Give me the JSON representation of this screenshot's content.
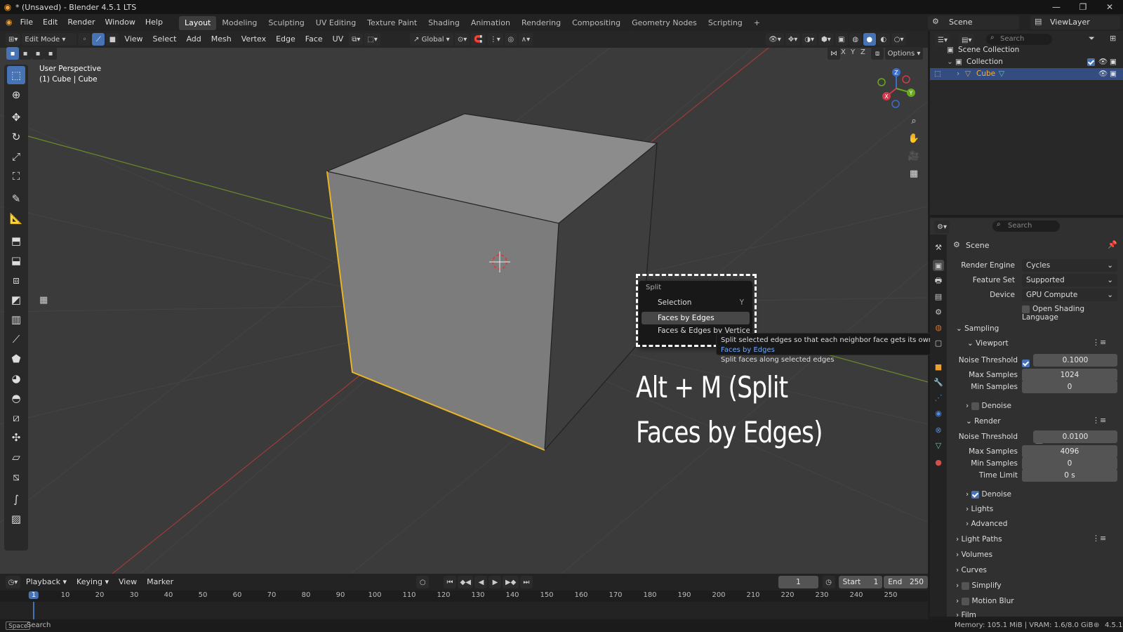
{
  "window": {
    "title": "* (Unsaved) - Blender 4.5.1 LTS"
  },
  "menus": [
    "File",
    "Edit",
    "Render",
    "Window",
    "Help"
  ],
  "workspaces": [
    "Layout",
    "Modeling",
    "Sculpting",
    "UV Editing",
    "Texture Paint",
    "Shading",
    "Animation",
    "Rendering",
    "Compositing",
    "Geometry Nodes",
    "Scripting"
  ],
  "active_workspace": "Layout",
  "scene": {
    "name": "Scene",
    "view_layer": "ViewLayer"
  },
  "viewport_header": {
    "mode": "Edit Mode",
    "menus": [
      "View",
      "Select",
      "Add",
      "Mesh",
      "Vertex",
      "Edge",
      "Face",
      "UV"
    ],
    "orientation": "Global",
    "options_label": "Options",
    "axes": [
      "X",
      "Y",
      "Z"
    ]
  },
  "viewport_info": {
    "line1": "User Perspective",
    "line2": "(1) Cube | Cube"
  },
  "split_menu": {
    "title": "Split",
    "items": [
      {
        "label": "Selection",
        "shortcut": "Y"
      },
      {
        "label": "Faces by Edges",
        "shortcut": ""
      },
      {
        "label": "Faces & Edges by Vertices",
        "shortcut": ""
      }
    ],
    "highlighted": "Faces by Edges"
  },
  "tooltip": {
    "line1": "Split selected edges so that each neighbor face gets its own copy:",
    "hint": "Faces by Edges",
    "line2": "Split faces along selected edges"
  },
  "overlay_caption": {
    "line1": "Alt + M (Split",
    "line2": "Faces by Edges)"
  },
  "outliner": {
    "search_placeholder": "Search",
    "rows": [
      {
        "label": "Scene Collection"
      },
      {
        "label": "Collection"
      },
      {
        "label": "Cube"
      }
    ]
  },
  "properties": {
    "search_placeholder": "Search",
    "context": "Scene",
    "render_engine_label": "Render Engine",
    "render_engine": "Cycles",
    "feature_set_label": "Feature Set",
    "feature_set": "Supported",
    "device_label": "Device",
    "device": "GPU Compute",
    "osl_label": "Open Shading Language",
    "sampling": "Sampling",
    "viewport": "Viewport",
    "render": "Render",
    "noise_threshold_label": "Noise Threshold",
    "max_samples_label": "Max Samples",
    "min_samples_label": "Min Samples",
    "time_limit_label": "Time Limit",
    "denoise_label": "Denoise",
    "viewport_noise_threshold": "0.1000",
    "viewport_max_samples": "1024",
    "viewport_min_samples": "0",
    "render_noise_threshold": "0.0100",
    "render_max_samples": "4096",
    "render_min_samples": "0",
    "render_time_limit": "0 s",
    "subsections": [
      "Lights",
      "Advanced"
    ],
    "panels": [
      "Light Paths",
      "Volumes",
      "Curves",
      "Simplify",
      "Motion Blur",
      "Film"
    ]
  },
  "timeline": {
    "menus": [
      "Playback",
      "Keying",
      "View",
      "Marker"
    ],
    "current_frame": "1",
    "start_label": "Start",
    "start": "1",
    "end_label": "End",
    "end": "250",
    "ticks": [
      "1",
      "10",
      "20",
      "30",
      "40",
      "50",
      "60",
      "70",
      "80",
      "90",
      "100",
      "110",
      "120",
      "130",
      "140",
      "150",
      "160",
      "170",
      "180",
      "190",
      "200",
      "210",
      "220",
      "230",
      "240",
      "250"
    ]
  },
  "statusbar": {
    "key": "Space",
    "action": "Search",
    "memory": "Memory: 105.1 MiB | VRAM: 1.6/8.0 GiB",
    "version": "4.5.1"
  },
  "colors": {
    "accent": "#4772b3",
    "selection": "#e8b428",
    "viewport_bg": "#3b3b3b"
  }
}
